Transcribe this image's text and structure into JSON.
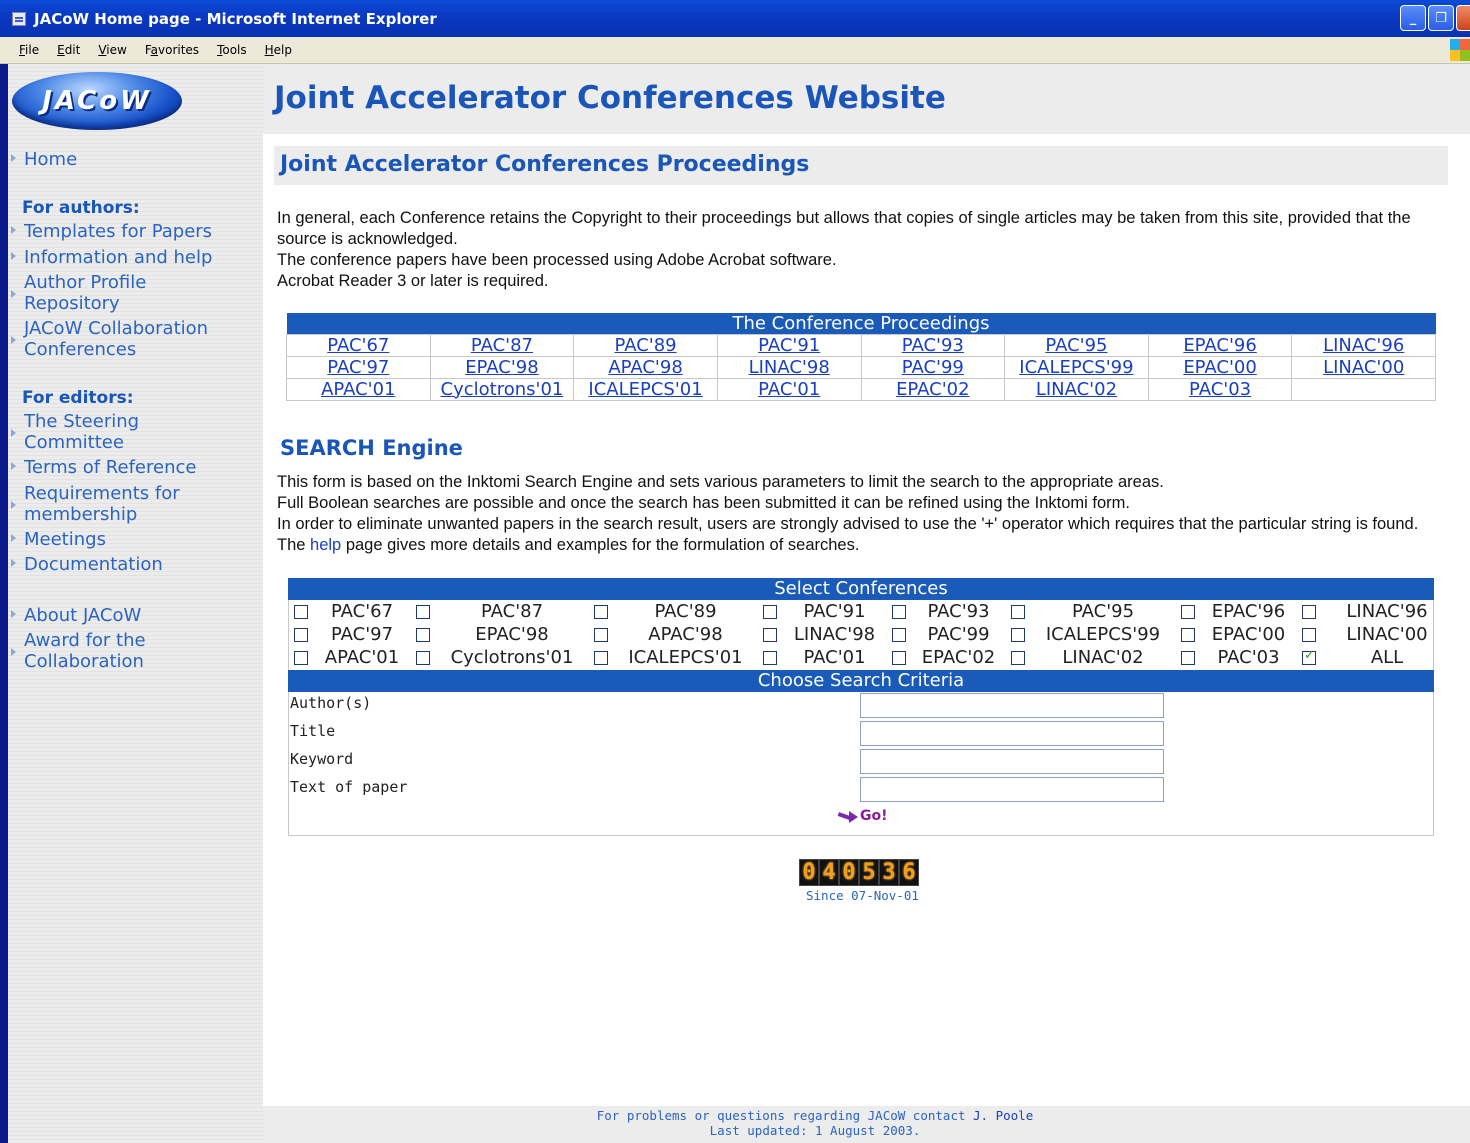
{
  "window": {
    "title": "JACoW Home page - Microsoft Internet Explorer",
    "menu": [
      {
        "label": "File",
        "key": "F"
      },
      {
        "label": "Edit",
        "key": "E"
      },
      {
        "label": "View",
        "key": "V"
      },
      {
        "label": "Favorites",
        "key": "a"
      },
      {
        "label": "Tools",
        "key": "T"
      },
      {
        "label": "Help",
        "key": "H"
      }
    ]
  },
  "logo": {
    "text": "JACoW"
  },
  "site_title": "Joint Accelerator Conferences Website",
  "sidebar": {
    "home": "Home",
    "authors_heading": "For authors:",
    "author_links": [
      "Templates for Papers",
      "Information and help",
      "Author Profile Repository",
      "JACoW Collaboration Conferences"
    ],
    "editors_heading": "For editors:",
    "editor_links": [
      "The Steering Committee",
      "Terms of Reference",
      "Requirements for membership",
      "Meetings",
      "Documentation"
    ],
    "other_links": [
      "About JACoW",
      "Award for the Collaboration"
    ]
  },
  "proceedings": {
    "heading": "Joint Accelerator Conferences Proceedings",
    "intro": [
      "In general, each Conference retains the Copyright to their proceedings but allows that copies of single articles may be taken from this site, provided that the source is acknowledged.",
      "The conference papers have been processed using Adobe Acrobat software.",
      "Acrobat Reader 3 or later is required."
    ],
    "table_title": "The Conference Proceedings",
    "rows": [
      [
        "PAC'67",
        "PAC'87",
        "PAC'89",
        "PAC'91",
        "PAC'93",
        "PAC'95",
        "EPAC'96",
        "LINAC'96"
      ],
      [
        "PAC'97",
        "EPAC'98",
        "APAC'98",
        "LINAC'98",
        "PAC'99",
        "ICALEPCS'99",
        "EPAC'00",
        "LINAC'00"
      ],
      [
        "APAC'01",
        "Cyclotrons'01",
        "ICALEPCS'01",
        "PAC'01",
        "EPAC'02",
        "LINAC'02",
        "PAC'03",
        ""
      ]
    ]
  },
  "search": {
    "heading": "SEARCH Engine",
    "intro": [
      "This form is based on the Inktomi Search Engine and sets various parameters to limit the search to the appropriate areas.",
      "Full Boolean searches are possible and once the search has been submitted it can be refined using the Inktomi form.",
      "In order to eliminate unwanted papers in the search result, users are strongly advised to use the '+' operator which requires that the particular string is found."
    ],
    "help_pre": "The ",
    "help_link": "help",
    "help_post": " page gives more details and examples for the formulation of searches.",
    "select_title": "Select Conferences",
    "conferences": [
      [
        {
          "label": "PAC'67",
          "checked": false
        },
        {
          "label": "PAC'87",
          "checked": false
        },
        {
          "label": "PAC'89",
          "checked": false
        },
        {
          "label": "PAC'91",
          "checked": false
        },
        {
          "label": "PAC'93",
          "checked": false
        },
        {
          "label": "PAC'95",
          "checked": false
        },
        {
          "label": "EPAC'96",
          "checked": false
        },
        {
          "label": "LINAC'96",
          "checked": false
        }
      ],
      [
        {
          "label": "PAC'97",
          "checked": false
        },
        {
          "label": "EPAC'98",
          "checked": false
        },
        {
          "label": "APAC'98",
          "checked": false
        },
        {
          "label": "LINAC'98",
          "checked": false
        },
        {
          "label": "PAC'99",
          "checked": false
        },
        {
          "label": "ICALEPCS'99",
          "checked": false
        },
        {
          "label": "EPAC'00",
          "checked": false
        },
        {
          "label": "LINAC'00",
          "checked": false
        }
      ],
      [
        {
          "label": "APAC'01",
          "checked": false
        },
        {
          "label": "Cyclotrons'01",
          "checked": false
        },
        {
          "label": "ICALEPCS'01",
          "checked": false
        },
        {
          "label": "PAC'01",
          "checked": false
        },
        {
          "label": "EPAC'02",
          "checked": false
        },
        {
          "label": "LINAC'02",
          "checked": false
        },
        {
          "label": "PAC'03",
          "checked": false
        },
        {
          "label": "ALL",
          "checked": true
        }
      ]
    ],
    "criteria_title": "Choose Search Criteria",
    "criteria": [
      {
        "label": "Author(s)",
        "value": ""
      },
      {
        "label": "Title",
        "value": ""
      },
      {
        "label": "Keyword",
        "value": ""
      },
      {
        "label": "Text of paper",
        "value": ""
      }
    ],
    "go_label": "Go!"
  },
  "counter": {
    "digits": "040536",
    "since": "Since 07-Nov-01"
  },
  "footer": {
    "contact_pre": "For problems or questions regarding JACoW contact ",
    "contact_name": "J. Poole",
    "updated": "Last updated: 1 August 2003."
  }
}
